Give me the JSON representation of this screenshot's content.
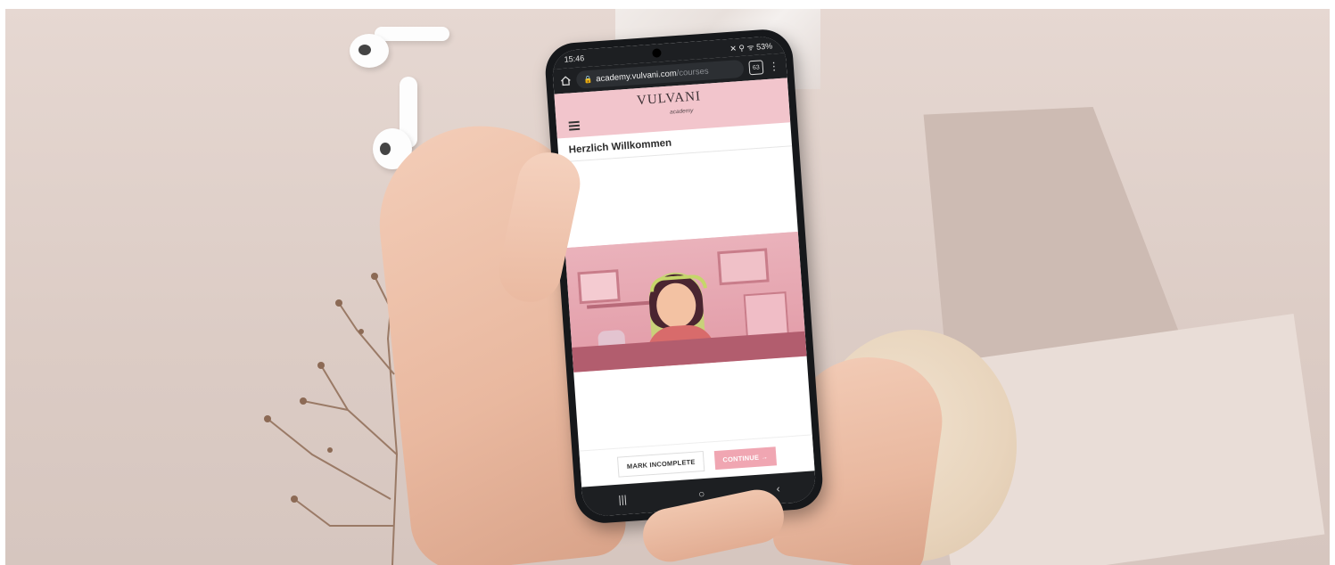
{
  "status_bar": {
    "time": "15:46",
    "indicators": "✕ ⚲ ᯤ 53%"
  },
  "browser": {
    "url_main": "academy.vulvani.com",
    "url_rest": "/courses",
    "tabs_count": "63",
    "home_icon": "home-icon",
    "lock_icon": "lock-icon",
    "menu_icon": "more-vert-icon"
  },
  "site": {
    "logo": "VULVANI",
    "logo_sub": "academy",
    "menu_icon": "hamburger-icon",
    "accent_color": "#f2c5cc"
  },
  "lesson": {
    "title": "Herzlich Willkommen"
  },
  "actions": {
    "mark_incomplete": "MARK INCOMPLETE",
    "continue": "CONTINUE →"
  },
  "android_nav": {
    "recents": "|||",
    "home": "○",
    "back": "‹"
  }
}
